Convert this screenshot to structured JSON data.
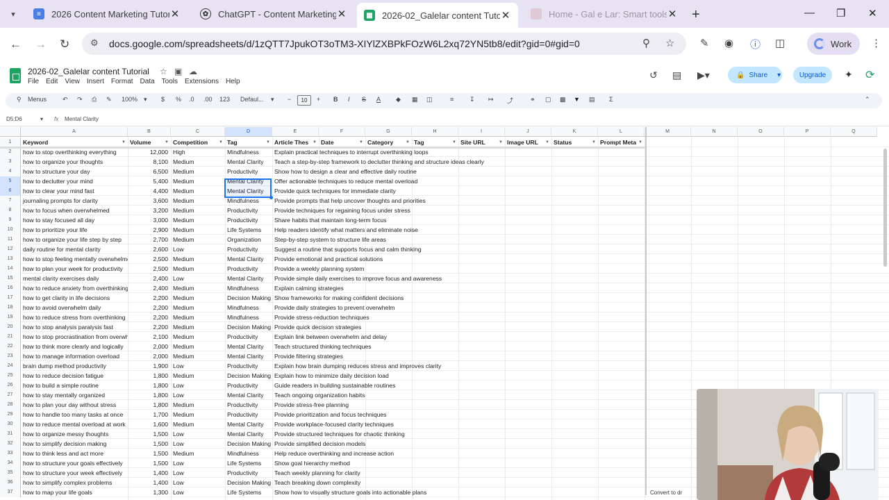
{
  "browser": {
    "tabs": [
      {
        "title": "2026 Content Marketing Tutori",
        "icon": "google-docs-icon",
        "color": "#4a7ee6"
      },
      {
        "title": "ChatGPT - Content Marketing",
        "icon": "chatgpt-icon",
        "color": "#333333"
      },
      {
        "title": "2026-02_Galelar content Tutori",
        "icon": "google-sheets-icon",
        "color": "#1ea362"
      },
      {
        "title": "Home - Gal e Lar: Smart tools f",
        "icon": "site-icon",
        "color": "#c9a0b8"
      }
    ],
    "url": "docs.google.com/spreadsheets/d/1zQTT7JpukOT3oTM3-XIYlZXBPkFOzW6L2xq72YN5tb8/edit?gid=0#gid=0",
    "profile": "Work"
  },
  "sheet": {
    "title": "2026-02_Galelar content Tutorial",
    "menus": [
      "File",
      "Edit",
      "View",
      "Insert",
      "Format",
      "Data",
      "Tools",
      "Extensions",
      "Help"
    ],
    "share": "Share",
    "upgrade": "Upgrade",
    "toolbar": {
      "search": "Menus",
      "zoom": "100%",
      "currency": "$",
      "percent": "%",
      "dec_minus": ".0",
      "dec_plus": ".00",
      "num": "123",
      "font": "Defaul...",
      "font_size": "10"
    },
    "name_box": "D5:D6",
    "formula_value": "Mental Clarity",
    "column_letters": [
      "A",
      "B",
      "C",
      "D",
      "E",
      "F",
      "G",
      "H",
      "I",
      "J",
      "K",
      "L",
      "M",
      "N",
      "O",
      "P",
      "Q"
    ],
    "headers": [
      "Keyword",
      "Volume",
      "Competition",
      "Tag",
      "Article Thes",
      "Date",
      "Category",
      "Tag",
      "Site URL",
      "Image URL",
      "Status",
      "Prompt Meta"
    ],
    "rows": [
      [
        "how to stop overthinking everything",
        "12,000",
        "High",
        "Mindfulness",
        "Explain practical techniques to interrupt overthinking loops"
      ],
      [
        "how to organize your thoughts",
        "8,100",
        "Medium",
        "Mental Clarity",
        "Teach a step-by-step framework to declutter thinking and structure ideas clearly"
      ],
      [
        "how to structure your day",
        "6,500",
        "Medium",
        "Productivity",
        "Show how to design a clear and effective daily routine"
      ],
      [
        "how to declutter your mind",
        "5,400",
        "Medium",
        "Mental Clarity",
        "Offer actionable techniques to reduce mental overload"
      ],
      [
        "how to clear your mind fast",
        "4,400",
        "Medium",
        "Mental Clarity",
        "Provide quick techniques for immediate clarity"
      ],
      [
        "journaling prompts for clarity",
        "3,600",
        "Medium",
        "Mindfulness",
        "Provide prompts that help uncover thoughts and priorities"
      ],
      [
        "how to focus when overwhelmed",
        "3,200",
        "Medium",
        "Productivity",
        "Provide techniques for regaining focus under stress"
      ],
      [
        "how to stay focused all day",
        "3,000",
        "Medium",
        "Productivity",
        "Share habits that maintain long-term focus"
      ],
      [
        "how to prioritize your life",
        "2,900",
        "Medium",
        "Life Systems",
        "Help readers identify what matters and eliminate noise"
      ],
      [
        "how to organize your life step by step",
        "2,700",
        "Medium",
        "Organization",
        "Step-by-step system to structure life areas"
      ],
      [
        "daily routine for mental clarity",
        "2,600",
        "Low",
        "Productivity",
        "Suggest a routine that supports focus and calm thinking"
      ],
      [
        "how to stop feeling mentally overwhelmed",
        "2,500",
        "Medium",
        "Mental Clarity",
        "Provide emotional and practical solutions"
      ],
      [
        "how to plan your week for productivity",
        "2,500",
        "Medium",
        "Productivity",
        "Provide a weekly planning system"
      ],
      [
        "mental clarity exercises daily",
        "2,400",
        "Low",
        "Mental Clarity",
        "Provide simple daily exercises to improve focus and awareness"
      ],
      [
        "how to reduce anxiety from overthinking",
        "2,400",
        "Medium",
        "Mindfulness",
        "Explain calming strategies"
      ],
      [
        "how to get clarity in life decisions",
        "2,200",
        "Medium",
        "Decision Making",
        "Show frameworks for making confident decisions"
      ],
      [
        "how to avoid overwhelm daily",
        "2,200",
        "Medium",
        "Mindfulness",
        "Provide daily strategies to prevent overwhelm"
      ],
      [
        "how to reduce stress from overthinking",
        "2,200",
        "Medium",
        "Mindfulness",
        "Provide stress-reduction techniques"
      ],
      [
        "how to stop analysis paralysis fast",
        "2,200",
        "Medium",
        "Decision Making",
        "Provide quick decision strategies"
      ],
      [
        "how to stop procrastination from overwhelm",
        "2,100",
        "Medium",
        "Productivity",
        "Explain link between overwhelm and delay"
      ],
      [
        "how to think more clearly and logically",
        "2,000",
        "Medium",
        "Mental Clarity",
        "Teach structured thinking techniques"
      ],
      [
        "how to manage information overload",
        "2,000",
        "Medium",
        "Mental Clarity",
        "Provide filtering strategies"
      ],
      [
        "brain dump method productivity",
        "1,900",
        "Low",
        "Productivity",
        "Explain how brain dumping reduces stress and improves clarity"
      ],
      [
        "how to reduce decision fatigue",
        "1,800",
        "Medium",
        "Decision Making",
        "Explain how to minimize daily decision load"
      ],
      [
        "how to build a simple routine",
        "1,800",
        "Low",
        "Productivity",
        "Guide readers in building sustainable routines"
      ],
      [
        "how to stay mentally organized",
        "1,800",
        "Low",
        "Mental Clarity",
        "Teach ongoing organization habits"
      ],
      [
        "how to plan your day without stress",
        "1,800",
        "Medium",
        "Productivity",
        "Provide stress-free planning"
      ],
      [
        "how to handle too many tasks at once",
        "1,700",
        "Medium",
        "Productivity",
        "Provide prioritization and focus techniques"
      ],
      [
        "how to reduce mental overload at work",
        "1,600",
        "Medium",
        "Mental Clarity",
        "Provide workplace-focused clarity techniques"
      ],
      [
        "how to organize messy thoughts",
        "1,500",
        "Low",
        "Mental Clarity",
        "Provide structured techniques for chaotic thinking"
      ],
      [
        "how to simplify decision making",
        "1,500",
        "Low",
        "Decision Making",
        "Provide simplified decision models"
      ],
      [
        "how to think less and act more",
        "1,500",
        "Medium",
        "Mindfulness",
        "Help reduce overthinking and increase action"
      ],
      [
        "how to structure your goals effectively",
        "1,500",
        "Low",
        "Life Systems",
        "Show goal hierarchy method"
      ],
      [
        "how to structure your week effectively",
        "1,400",
        "Low",
        "Productivity",
        "Teach weekly planning for clarity"
      ],
      [
        "how to simplify complex problems",
        "1,400",
        "Low",
        "Decision Making",
        "Teach breaking down complexity"
      ],
      [
        "how to map your life goals",
        "1,300",
        "Low",
        "Life Systems",
        "Show how to visually structure goals into actionable plans"
      ]
    ],
    "convert_hint": "Convert to dr"
  }
}
